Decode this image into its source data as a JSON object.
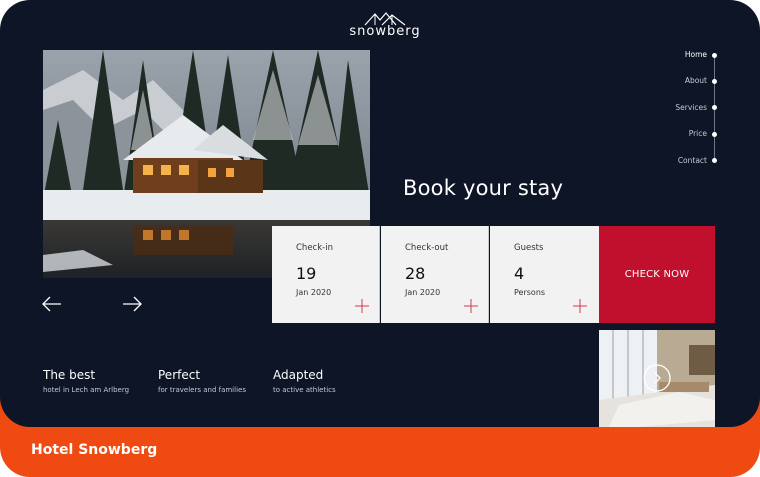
{
  "brand": {
    "logo_text": "snowberg",
    "footer_title": "Hotel Snowberg"
  },
  "nav": {
    "items": [
      {
        "label": "Home",
        "active": true
      },
      {
        "label": "About",
        "active": false
      },
      {
        "label": "Services",
        "active": false
      },
      {
        "label": "Price",
        "active": false
      },
      {
        "label": "Contact",
        "active": false
      }
    ]
  },
  "main": {
    "heading": "Book your stay"
  },
  "booking": {
    "checkin": {
      "label": "Check-in",
      "value": "19",
      "sub": "Jan 2020"
    },
    "checkout": {
      "label": "Check-out",
      "value": "28",
      "sub": "Jan 2020"
    },
    "guests": {
      "label": "Guests",
      "value": "4",
      "sub": "Persons"
    },
    "button_label": "CHECK NOW"
  },
  "features": [
    {
      "title": "The best",
      "sub": "hotel in Lech am Arlberg"
    },
    {
      "title": "Perfect",
      "sub": "for travelers and families"
    },
    {
      "title": "Adapted",
      "sub": "to active athletics"
    }
  ],
  "icons": {
    "prev": "arrow-left-icon",
    "next": "arrow-right-icon",
    "plus": "plus-icon",
    "room_next": "chevron-right-icon"
  },
  "colors": {
    "background": "#0d1526",
    "accent_red": "#c0102d",
    "footer_orange": "#ee4a12",
    "plus_red": "#d23a4b"
  }
}
